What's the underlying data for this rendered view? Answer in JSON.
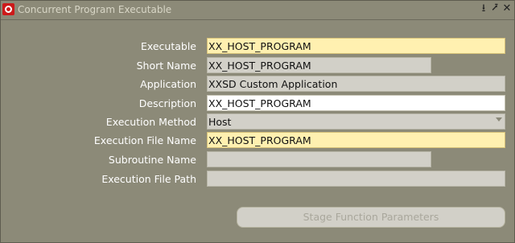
{
  "window": {
    "title": "Concurrent Program Executable",
    "controls": {
      "minimize": "⭳",
      "maximize": "⭷",
      "close": "✕"
    }
  },
  "form": {
    "executable": {
      "label": "Executable",
      "value": "XX_HOST_PROGRAM"
    },
    "short_name": {
      "label": "Short Name",
      "value": "XX_HOST_PROGRAM"
    },
    "application": {
      "label": "Application",
      "value": "XXSD Custom Application"
    },
    "description": {
      "label": "Description",
      "value": "XX_HOST_PROGRAM"
    },
    "execution_method": {
      "label": "Execution Method",
      "value": "Host"
    },
    "execution_file_name": {
      "label": "Execution File Name",
      "value": "XX_HOST_PROGRAM"
    },
    "subroutine_name": {
      "label": "Subroutine Name",
      "value": ""
    },
    "execution_file_path": {
      "label": "Execution File Path",
      "value": ""
    }
  },
  "buttons": {
    "stage_function_parameters": "Stage Function Parameters"
  },
  "colors": {
    "background": "#8c8a78",
    "required_field": "#fff0b0",
    "readonly_field": "#d2d0c8",
    "editable_field": "#ffffff"
  }
}
